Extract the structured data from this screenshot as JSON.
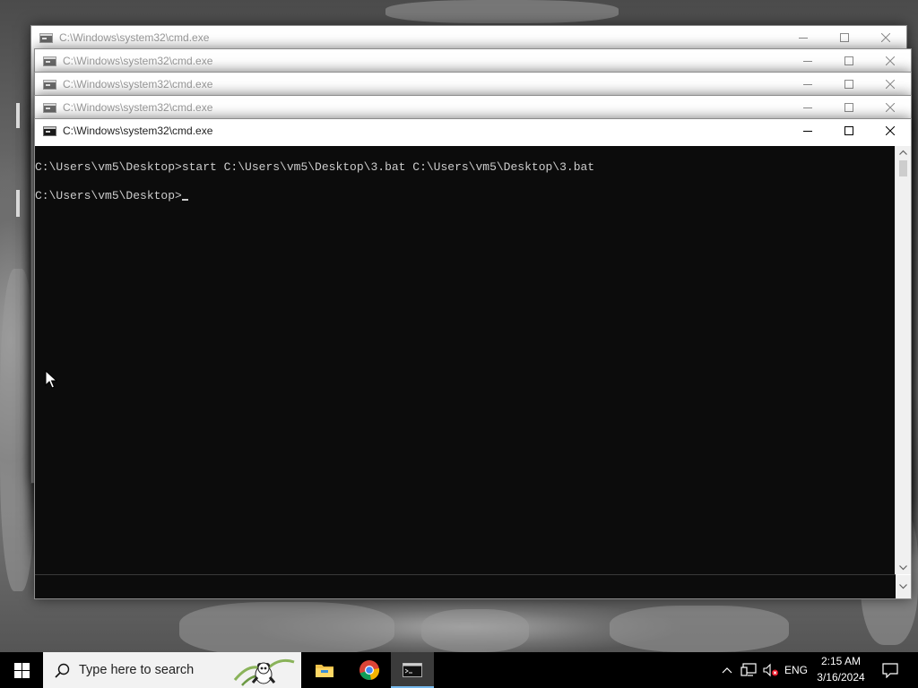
{
  "windows": [
    {
      "title": "C:\\Windows\\system32\\cmd.exe",
      "state": "inactive"
    },
    {
      "title": "C:\\Windows\\system32\\cmd.exe",
      "state": "inactive"
    },
    {
      "title": "C:\\Windows\\system32\\cmd.exe",
      "state": "inactive"
    },
    {
      "title": "C:\\Windows\\system32\\cmd.exe",
      "state": "inactive"
    },
    {
      "title": "C:\\Windows\\system32\\cmd.exe",
      "state": "active"
    }
  ],
  "console": {
    "line1": "C:\\Users\\vm5\\Desktop>start C:\\Users\\vm5\\Desktop\\3.bat C:\\Users\\vm5\\Desktop\\3.bat",
    "prompt": "C:\\Users\\vm5\\Desktop>",
    "colors": {
      "background": "#0c0c0c",
      "text": "#cccccc"
    }
  },
  "taskbar": {
    "search_placeholder": "Type here to search",
    "apps": [
      "file-explorer-icon",
      "chrome-icon",
      "cmd-icon"
    ],
    "tray": {
      "language": "ENG",
      "time": "2:15 AM",
      "date": "3/16/2024"
    },
    "accent": "#76b9ed"
  }
}
